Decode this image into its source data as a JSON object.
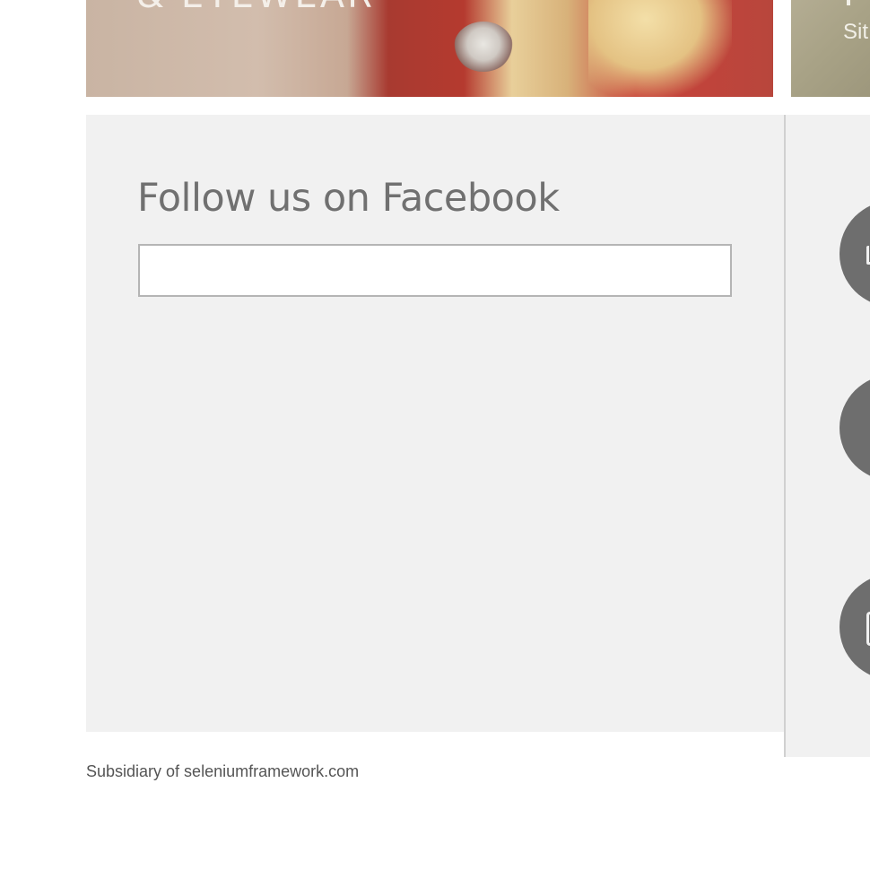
{
  "banners": {
    "left_text": "& EYEWEAR",
    "right_text": "Sit"
  },
  "facebook": {
    "title": "Follow us on Facebook"
  },
  "footer": {
    "text": "Subsidiary of seleniumframework.com"
  },
  "icons": [
    "contact-icon",
    "location-icon",
    "calendar-icon"
  ]
}
